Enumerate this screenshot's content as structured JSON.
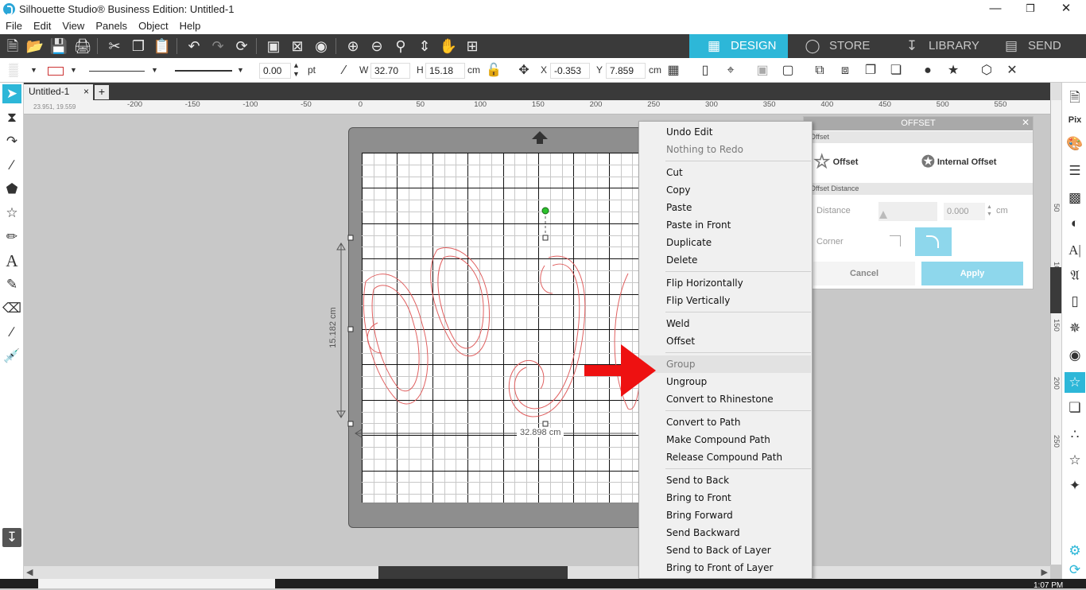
{
  "window": {
    "title": "Silhouette Studio® Business Edition: Untitled-1",
    "minimize": "—",
    "restore": "❐",
    "close": "✕"
  },
  "menu": [
    "File",
    "Edit",
    "View",
    "Panels",
    "Object",
    "Help"
  ],
  "nav_tabs": [
    {
      "label": "DESIGN",
      "icon": "grid-icon"
    },
    {
      "label": "STORE",
      "icon": "silhouette-s-icon"
    },
    {
      "label": "LIBRARY",
      "icon": "download-box-icon"
    },
    {
      "label": "SEND",
      "icon": "cutter-icon"
    }
  ],
  "toolbar2": {
    "line_weight": "0.00",
    "line_unit": "pt",
    "w_label": "W",
    "w_value": "32.70",
    "h_label": "H",
    "h_value": "15.18",
    "size_unit": "cm",
    "x_label": "X",
    "x_value": "-0.353",
    "y_label": "Y",
    "y_value": "7.859",
    "pos_unit": "cm"
  },
  "doc_tab": {
    "name": "Untitled-1",
    "close": "×",
    "add": "+"
  },
  "ruler": {
    "coords": "23.951, 19.559",
    "h_ticks": [
      "-200",
      "-150",
      "-100",
      "-50",
      "0",
      "50",
      "100",
      "150",
      "200",
      "250",
      "300",
      "350",
      "400",
      "450",
      "500",
      "550"
    ],
    "v_ticks": [
      "50",
      "100",
      "150",
      "200",
      "250"
    ]
  },
  "dimensions": {
    "height": "15.182 cm",
    "width": "32.898 cm"
  },
  "offset_panel": {
    "title": "OFFSET",
    "close": "✕",
    "section_offset": "Offset",
    "offset_btn": "Offset",
    "internal_offset_btn": "Internal Offset",
    "section_distance": "Offset Distance",
    "distance_label": "Distance",
    "distance_value": "0.000",
    "distance_unit": "cm",
    "corner_label": "Corner",
    "cancel": "Cancel",
    "apply": "Apply"
  },
  "context_menu": {
    "groups": [
      [
        {
          "label": "Undo Edit",
          "enabled": true
        },
        {
          "label": "Nothing to Redo",
          "enabled": false
        }
      ],
      [
        {
          "label": "Cut",
          "enabled": true
        },
        {
          "label": "Copy",
          "enabled": true
        },
        {
          "label": "Paste",
          "enabled": true
        },
        {
          "label": "Paste in Front",
          "enabled": true
        },
        {
          "label": "Duplicate",
          "enabled": true
        },
        {
          "label": "Delete",
          "enabled": true
        }
      ],
      [
        {
          "label": "Flip Horizontally",
          "enabled": true
        },
        {
          "label": "Flip Vertically",
          "enabled": true
        }
      ],
      [
        {
          "label": "Weld",
          "enabled": true
        },
        {
          "label": "Offset",
          "enabled": true
        }
      ],
      [
        {
          "label": "Group",
          "enabled": false,
          "highlighted": true
        },
        {
          "label": "Ungroup",
          "enabled": true
        },
        {
          "label": "Convert to Rhinestone",
          "enabled": true
        }
      ],
      [
        {
          "label": "Convert to Path",
          "enabled": true
        },
        {
          "label": "Make Compound Path",
          "enabled": true
        },
        {
          "label": "Release Compound Path",
          "enabled": true
        }
      ],
      [
        {
          "label": "Send to Back",
          "enabled": true
        },
        {
          "label": "Bring to Front",
          "enabled": true
        },
        {
          "label": "Bring Forward",
          "enabled": true
        },
        {
          "label": "Send Backward",
          "enabled": true
        },
        {
          "label": "Send to Back of Layer",
          "enabled": true
        },
        {
          "label": "Bring to Front of Layer",
          "enabled": true
        }
      ]
    ]
  },
  "taskbar": {
    "clock": "1:07 PM"
  },
  "colors": {
    "accent": "#2db7d8",
    "toolbar": "#3a3a3a",
    "cut_line": "#e06060",
    "arrow": "#ee1111"
  }
}
